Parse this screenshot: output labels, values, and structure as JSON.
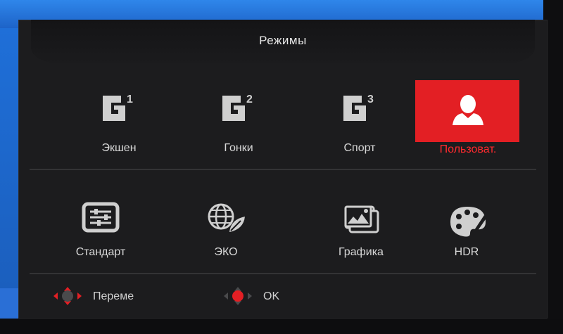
{
  "osd": {
    "title": "Режимы",
    "modes_row1": [
      {
        "label": "Экшен",
        "icon": "g1-icon",
        "badge": "1"
      },
      {
        "label": "Гонки",
        "icon": "g2-icon",
        "badge": "2"
      },
      {
        "label": "Спорт",
        "icon": "g3-icon",
        "badge": "3"
      },
      {
        "label": "Пользоват.",
        "icon": "user-icon",
        "selected": true
      }
    ],
    "modes_row2": [
      {
        "label": "Стандарт",
        "icon": "sliders-icon"
      },
      {
        "label": "ЭКО",
        "icon": "eco-globe-icon"
      },
      {
        "label": "Графика",
        "icon": "pictures-icon"
      },
      {
        "label": "HDR",
        "icon": "palette-icon"
      }
    ],
    "hints": [
      {
        "label": "Переме",
        "icon": "joystick-move-icon"
      },
      {
        "label": "OK",
        "icon": "joystick-press-icon"
      }
    ],
    "colors": {
      "accent": "#e31f24",
      "background": "#1c1c1e",
      "text": "#d6d6d6"
    }
  }
}
